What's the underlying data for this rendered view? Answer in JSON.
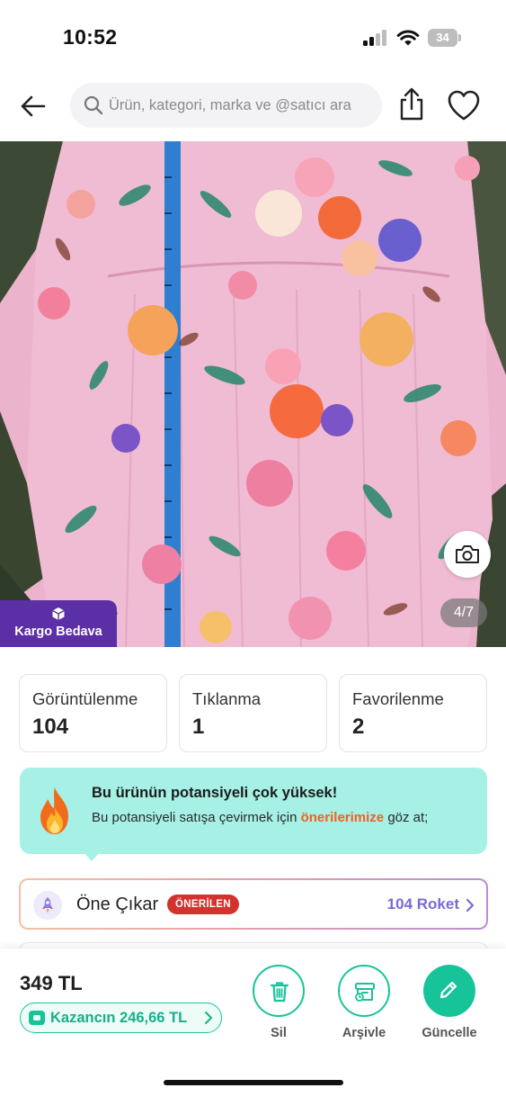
{
  "status_bar": {
    "time": "10:52",
    "battery": "34"
  },
  "header": {
    "search_placeholder": "Ürün, kategori, marka ve @satıcı ara",
    "back_icon": "arrow-left-icon",
    "share_icon": "share-icon",
    "favorite_icon": "heart-icon"
  },
  "gallery": {
    "counter": "4/7",
    "cargo_label": "Kargo Bedava",
    "camera_icon": "camera-icon"
  },
  "stats": [
    {
      "label": "Görüntülenme",
      "value": "104"
    },
    {
      "label": "Tıklanma",
      "value": "1"
    },
    {
      "label": "Favorilenme",
      "value": "2"
    }
  ],
  "potential": {
    "title": "Bu ürünün potansiyeli çok yüksek!",
    "text_before": "Bu potansiyeli satışa çevirmek için ",
    "link": "önerilerimize",
    "text_after": " göz at;"
  },
  "feature": {
    "label": "Öne Çıkar",
    "badge": "ÖNERİLEN",
    "rocket": "104 Roket"
  },
  "bottom": {
    "price": "349 TL",
    "earning": "Kazancın 246,66 TL",
    "actions": {
      "delete": "Sil",
      "archive": "Arşivle",
      "update": "Güncelle"
    }
  },
  "colors": {
    "accent_green": "#17c49a",
    "cargo_purple": "#5b2fa6",
    "banner_mint": "#a7f0e6",
    "link_orange": "#f2601e",
    "badge_red": "#d5322f",
    "rocket_purple": "#7a6ad6"
  }
}
